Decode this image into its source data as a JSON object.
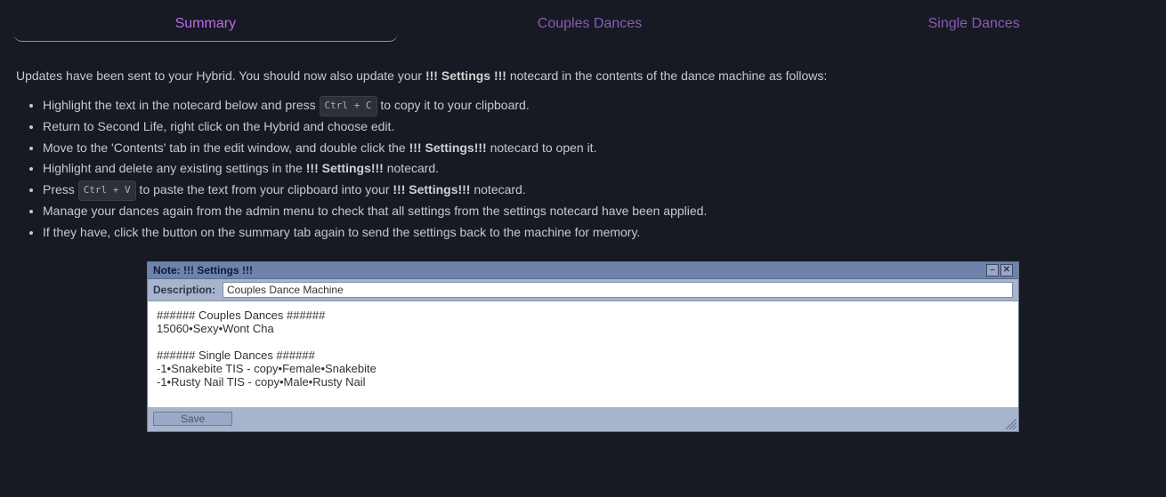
{
  "tabs": {
    "summary": "Summary",
    "couples": "Couples Dances",
    "single": "Single Dances"
  },
  "intro": {
    "pre": "Updates have been sent to your Hybrid. You should now also update your ",
    "bold": "!!! Settings !!!",
    "post": " notecard in the contents of the dance machine as follows:"
  },
  "kbd": {
    "copy": "Ctrl + C",
    "paste": "Ctrl + V"
  },
  "steps": {
    "s1a": "Highlight the text in the notecard below and press ",
    "s1b": " to copy it to your clipboard.",
    "s2": "Return to Second Life, right click on the Hybrid and choose edit.",
    "s3a": "Move to the 'Contents' tab in the edit window, and double click the ",
    "s3bold": "!!! Settings!!!",
    "s3b": " notecard to open it.",
    "s4a": "Highlight and delete any existing settings in the ",
    "s4bold": "!!! Settings!!!",
    "s4b": " notecard.",
    "s5a": "Press ",
    "s5b": " to paste the text from your clipboard into your ",
    "s5bold": "!!! Settings!!!",
    "s5c": " notecard.",
    "s6": "Manage your dances again from the admin menu to check that all settings from the settings notecard have been applied.",
    "s7": "If they have, click the button on the summary tab again to send the settings back to the machine for memory."
  },
  "notecard": {
    "title": "Note: !!! Settings !!!",
    "desc_label": "Description:",
    "description": "Couples Dance Machine",
    "body": "###### Couples Dances ######\n15060•Sexy•Wont Cha\n\n###### Single Dances ######\n-1•Snakebite TIS - copy•Female•Snakebite\n-1•Rusty Nail TIS - copy•Male•Rusty Nail",
    "save": "Save",
    "minimize": "–",
    "close": "✕"
  }
}
